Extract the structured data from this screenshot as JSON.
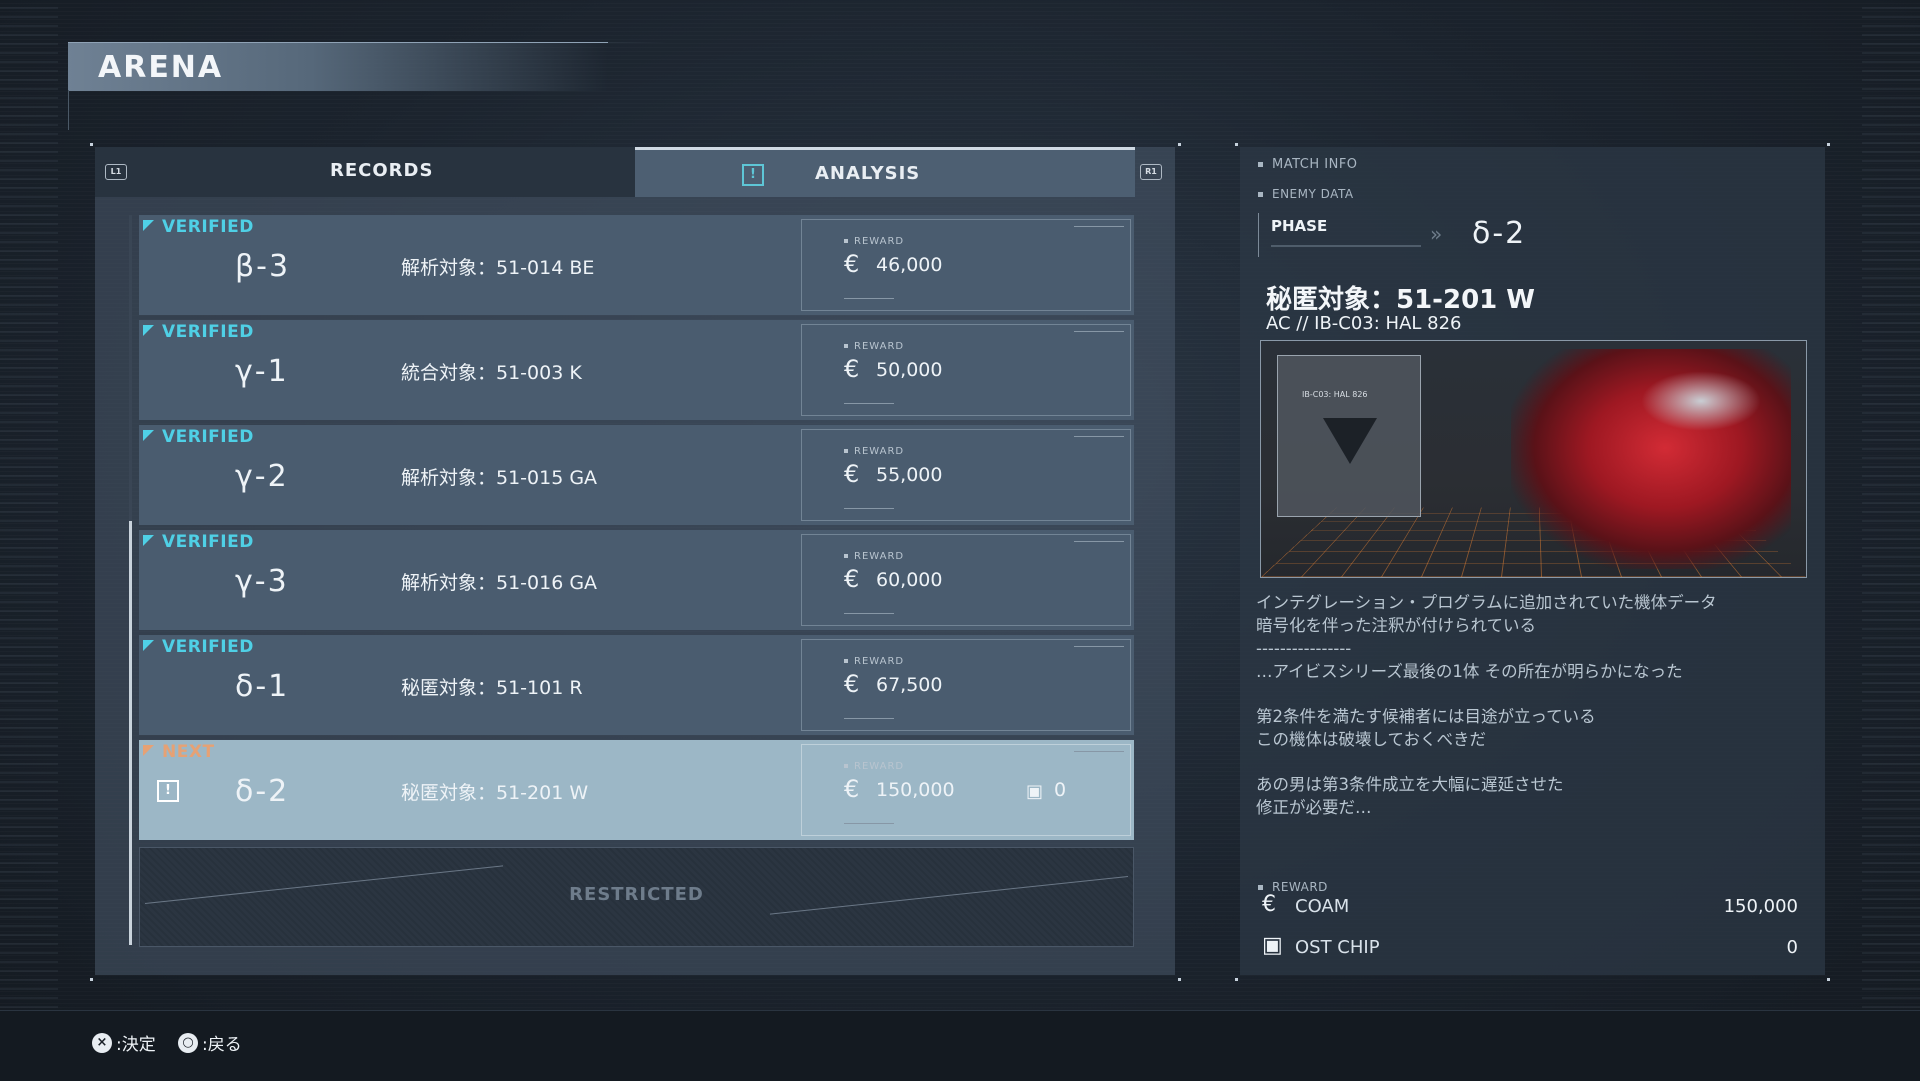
{
  "header": {
    "title": "ARENA"
  },
  "tabs": {
    "left_hint": "L1",
    "right_hint": "R1",
    "records": "RECORDS",
    "analysis": "ANALYSIS",
    "analysis_alert": "!"
  },
  "rows": [
    {
      "status": "VERIFIED",
      "code": "β-3",
      "target": "解析対象：51-014 BE",
      "reward_label": "REWARD",
      "currency": "€",
      "reward": "46,000"
    },
    {
      "status": "VERIFIED",
      "code": "γ-1",
      "target": "統合対象：51-003 K",
      "reward_label": "REWARD",
      "currency": "€",
      "reward": "50,000"
    },
    {
      "status": "VERIFIED",
      "code": "γ-2",
      "target": "解析対象：51-015 GA",
      "reward_label": "REWARD",
      "currency": "€",
      "reward": "55,000"
    },
    {
      "status": "VERIFIED",
      "code": "γ-3",
      "target": "解析対象：51-016 GA",
      "reward_label": "REWARD",
      "currency": "€",
      "reward": "60,000"
    },
    {
      "status": "VERIFIED",
      "code": "δ-1",
      "target": "秘匿対象：51-101 R",
      "reward_label": "REWARD",
      "currency": "€",
      "reward": "67,500"
    },
    {
      "status": "NEXT",
      "alert": "!",
      "code": "δ-2",
      "target": "秘匿対象：51-201 W",
      "reward_label": "REWARD",
      "currency": "€",
      "reward": "150,000",
      "chip_icon": "chip-icon",
      "chip_value": "0"
    }
  ],
  "restricted": {
    "label": "RESTRICTED"
  },
  "match_info": {
    "label": "MATCH INFO",
    "enemy_data_label": "ENEMY DATA",
    "phase_label": "PHASE",
    "phase_value": "δ-2",
    "enemy_name": "秘匿対象：51-201 W",
    "enemy_sub": "AC //  IB-C03: HAL 826",
    "emblem_text": "IB-C03: HAL 826",
    "description": [
      "インテグレーション・プログラムに追加されていた機体データ",
      "暗号化を伴った注釈が付けられている",
      "----------------",
      "…アイビスシリーズ最後の1体 その所在が明らかになった",
      "",
      "第2条件を満たす候補者には目途が立っている",
      "この機体は破壊しておくべきだ",
      "",
      "あの男は第3条件成立を大幅に遅延させた",
      "修正が必要だ…"
    ],
    "reward_label": "REWARD",
    "rewards": [
      {
        "icon": "€",
        "name": "COAM",
        "value": "150,000"
      },
      {
        "icon": "chip-icon",
        "name": "OST CHIP",
        "value": "0"
      }
    ]
  },
  "footer": {
    "confirm_icon": "×",
    "confirm_label": ":決定",
    "back_icon": "○",
    "back_label": ":戻る"
  },
  "colors": {
    "verified": "#4fd0e6",
    "next": "#e6a174",
    "selected_row": "#9cb7c6"
  }
}
